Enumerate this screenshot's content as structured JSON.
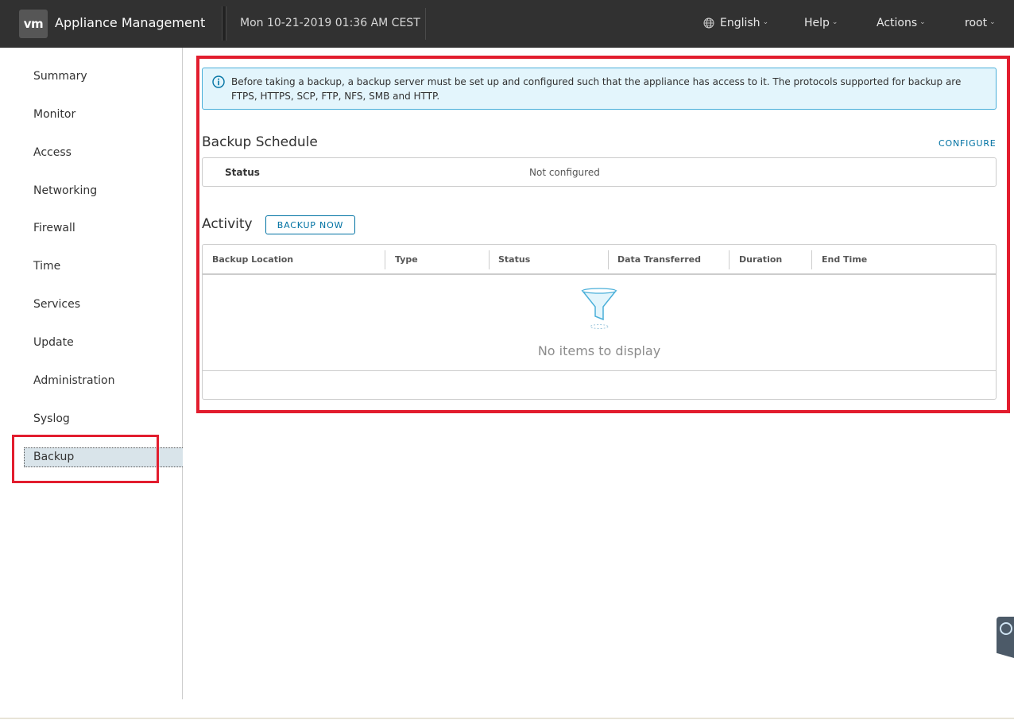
{
  "header": {
    "logo": "vm",
    "title": "Appliance Management",
    "datetime": "Mon 10-21-2019 01:36 AM CEST",
    "menus": {
      "language": "English",
      "help": "Help",
      "actions": "Actions",
      "user": "root"
    }
  },
  "sidebar": {
    "items": [
      "Summary",
      "Monitor",
      "Access",
      "Networking",
      "Firewall",
      "Time",
      "Services",
      "Update",
      "Administration",
      "Syslog",
      "Backup"
    ],
    "selected": "Backup"
  },
  "alert": {
    "text": "Before taking a backup, a backup server must be set up and configured such that the appliance has access to it. The protocols supported for backup are FTPS, HTTPS, SCP, FTP, NFS, SMB and HTTP."
  },
  "schedule": {
    "title": "Backup Schedule",
    "configure_label": "CONFIGURE",
    "status_label": "Status",
    "status_value": "Not configured"
  },
  "activity": {
    "title": "Activity",
    "backup_now_label": "BACKUP NOW",
    "columns": [
      "Backup Location",
      "Type",
      "Status",
      "Data Transferred",
      "Duration",
      "End Time"
    ],
    "empty_text": "No items to display"
  },
  "colors": {
    "header_bg": "#313131",
    "accent": "#0072a3",
    "highlight": "#e21d2e",
    "alert_bg": "#e3f5fc",
    "selected_nav_bg": "#d9e4ea"
  }
}
